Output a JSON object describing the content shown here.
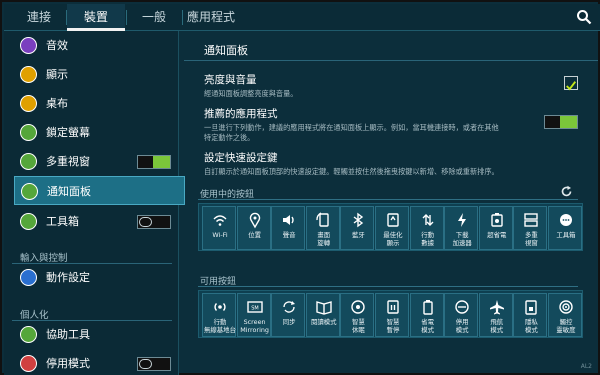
{
  "tabs": [
    {
      "label": "連接",
      "active": false
    },
    {
      "label": "裝置",
      "active": true
    },
    {
      "label": "一般",
      "active": false
    },
    {
      "label": "應用程式",
      "active": false
    }
  ],
  "sidebar": {
    "items": [
      {
        "label": "音效",
        "icon": "volume-icon",
        "iconColor": "#7a3fbf",
        "toggle": null
      },
      {
        "label": "顯示",
        "icon": "display-icon",
        "iconColor": "#e0a000",
        "toggle": null
      },
      {
        "label": "桌布",
        "icon": "wallpaper-icon",
        "iconColor": "#e0a000",
        "toggle": null
      },
      {
        "label": "鎖定螢幕",
        "icon": "lock-screen-icon",
        "iconColor": "#55a63a",
        "toggle": null
      },
      {
        "label": "多重視窗",
        "icon": "multi-window-icon",
        "iconColor": "#55a63a",
        "toggle": "on"
      },
      {
        "label": "通知面板",
        "icon": "notification-panel-icon",
        "iconColor": "#55a63a",
        "toggle": null
      },
      {
        "label": "工具箱",
        "icon": "toolbox-icon",
        "iconColor": "#55a63a",
        "toggle": "off"
      }
    ],
    "section_input": "輸入與控制",
    "motion": {
      "label": "動作設定",
      "icon": "motion-icon",
      "iconColor": "#2a6fd0"
    },
    "section_personal": "個人化",
    "personal_items": [
      {
        "label": "協助工具",
        "icon": "accessibility-icon",
        "iconColor": "#55a63a",
        "toggle": null
      },
      {
        "label": "停用模式",
        "icon": "blocking-mode-icon",
        "iconColor": "#d04040",
        "toggle": "off"
      }
    ]
  },
  "main": {
    "title": "通知面板",
    "brightness": {
      "title": "亮度與音量",
      "desc": "經通知面板調整亮度與音量。",
      "checked": true
    },
    "recommended": {
      "title": "推薦的應用程式",
      "desc1": "一旦進行下列動作，建議的應用程式將在通知面板上顯示。例如，當耳機連接時，或者在其他",
      "desc2": "特定動作之後。",
      "toggle": "on"
    },
    "quick": {
      "title": "設定快速設定鍵",
      "desc": "自訂顯示於通知面板頂部的快速設定鍵。輕觸並按住然後拖曳按鍵以新增、移除或重新排序。"
    },
    "active_header": "使用中的按鈕",
    "active_buttons": [
      {
        "label1": "Wi-Fi",
        "label2": "",
        "icon": "wifi-icon"
      },
      {
        "label1": "位置",
        "label2": "",
        "icon": "location-icon"
      },
      {
        "label1": "聲音",
        "label2": "",
        "icon": "sound-icon"
      },
      {
        "label1": "畫面",
        "label2": "旋轉",
        "icon": "rotate-icon"
      },
      {
        "label1": "藍牙",
        "label2": "",
        "icon": "bluetooth-icon"
      },
      {
        "label1": "最佳化",
        "label2": "顯示",
        "icon": "display-opt-icon"
      },
      {
        "label1": "行動",
        "label2": "數據",
        "icon": "mobile-data-icon"
      },
      {
        "label1": "下載",
        "label2": "加速器",
        "icon": "download-booster-icon"
      },
      {
        "label1": "超省電",
        "label2": "",
        "icon": "ultra-power-icon"
      },
      {
        "label1": "多重",
        "label2": "視窗",
        "icon": "multiwindow-icon"
      },
      {
        "label1": "工具箱",
        "label2": "",
        "icon": "toolbox-icon"
      }
    ],
    "available_header": "可用按鈕",
    "available_buttons": [
      {
        "label1": "行動",
        "label2": "無線基地台",
        "icon": "hotspot-icon"
      },
      {
        "label1": "Screen",
        "label2": "Mirroring",
        "icon": "screen-mirroring-icon"
      },
      {
        "label1": "同步",
        "label2": "",
        "icon": "sync-icon"
      },
      {
        "label1": "閱讀模式",
        "label2": "",
        "icon": "reading-mode-icon"
      },
      {
        "label1": "智慧",
        "label2": "休眠",
        "icon": "smart-stay-icon"
      },
      {
        "label1": "智慧",
        "label2": "暫停",
        "icon": "smart-pause-icon"
      },
      {
        "label1": "省電",
        "label2": "模式",
        "icon": "power-saving-icon"
      },
      {
        "label1": "停用",
        "label2": "模式",
        "icon": "blocking-icon"
      },
      {
        "label1": "飛航",
        "label2": "模式",
        "icon": "airplane-icon"
      },
      {
        "label1": "隱私",
        "label2": "模式",
        "icon": "private-mode-icon"
      },
      {
        "label1": "觸控",
        "label2": "靈敏度",
        "icon": "touch-sensitivity-icon"
      }
    ]
  },
  "watermark": "AL2"
}
